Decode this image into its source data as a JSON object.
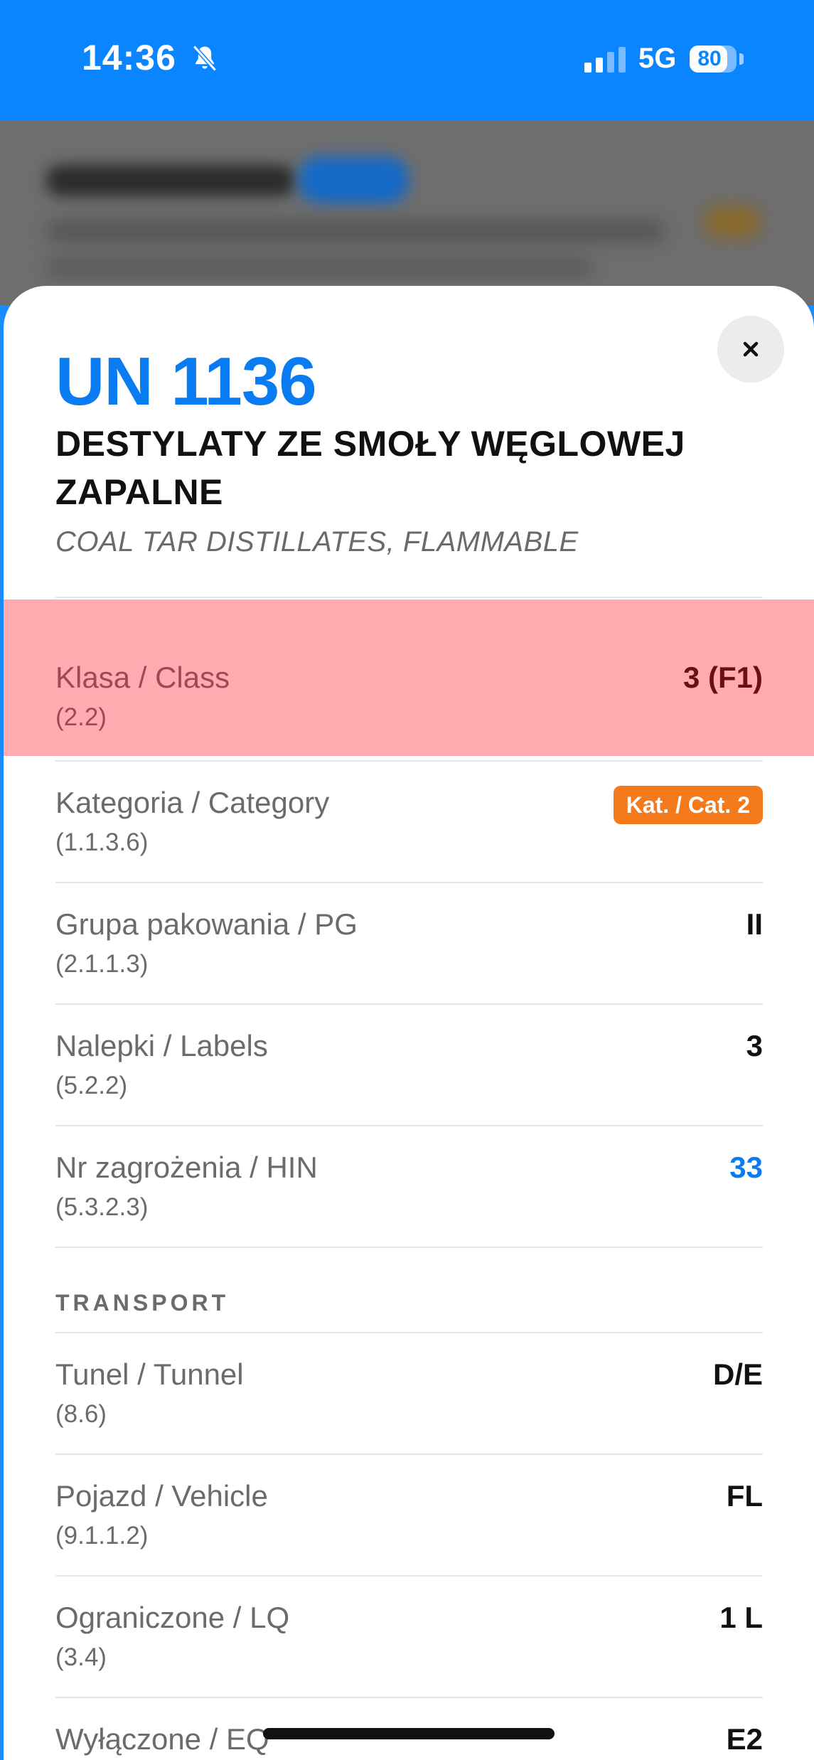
{
  "status_bar": {
    "time": "14:36",
    "network": "5G",
    "battery": "80",
    "battery_level": 0.8,
    "icons": [
      "bell-slash-icon",
      "signal-icon"
    ]
  },
  "sheet": {
    "un_number": "UN 1136",
    "title_pl": "DESTYLATY ZE SMOŁY WĘGLOWEJ ZAPALNE",
    "title_en": "COAL TAR DISTILLATES, FLAMMABLE",
    "rows": [
      {
        "label": "Klasa / Class",
        "ref": "(2.2)",
        "value": "3 (F1)"
      },
      {
        "label": "Kategoria / Category",
        "ref": "(1.1.3.6)",
        "value": "Kat. / Cat. 2"
      },
      {
        "label": "Grupa pakowania / PG",
        "ref": "(2.1.1.3)",
        "value": "II"
      },
      {
        "label": "Nalepki / Labels",
        "ref": "(5.2.2)",
        "value": "3"
      },
      {
        "label": "Nr zagrożenia / HIN",
        "ref": "(5.3.2.3)",
        "value": "33"
      }
    ],
    "transport_title": "TRANSPORT",
    "transport_rows": [
      {
        "label": "Tunel / Tunnel",
        "ref": "(8.6)",
        "value": "D/E"
      },
      {
        "label": "Pojazd / Vehicle",
        "ref": "(9.1.1.2)",
        "value": "FL"
      },
      {
        "label": "Ograniczone / LQ",
        "ref": "(3.4)",
        "value": "1 L"
      },
      {
        "label": "Wyłączone / EQ",
        "value": "E2"
      }
    ],
    "colors": {
      "accent": "#0a7cf2",
      "highlight": "#ffabb0",
      "badge": "#f57a1c",
      "status_bar": "#0a84ff"
    }
  }
}
